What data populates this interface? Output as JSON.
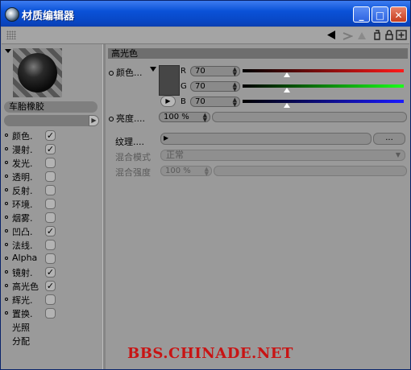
{
  "window": {
    "title": "材质编辑器",
    "minimize": "_",
    "maximize": "□",
    "close": "✕"
  },
  "material": {
    "name": "车胎橡胶"
  },
  "channels": [
    {
      "label": "颜色.",
      "checked": true,
      "dot": true
    },
    {
      "label": "漫射.",
      "checked": true,
      "dot": true
    },
    {
      "label": "发光.",
      "checked": false,
      "dot": true
    },
    {
      "label": "透明.",
      "checked": false,
      "dot": true
    },
    {
      "label": "反射.",
      "checked": false,
      "dot": true
    },
    {
      "label": "环境.",
      "checked": false,
      "dot": true
    },
    {
      "label": "烟雾.",
      "checked": false,
      "dot": true
    },
    {
      "label": "凹凸.",
      "checked": true,
      "dot": true
    },
    {
      "label": "法线.",
      "checked": false,
      "dot": true
    },
    {
      "label": "Alpha",
      "checked": false,
      "dot": true
    },
    {
      "label": "镜射.",
      "checked": true,
      "dot": true
    },
    {
      "label": "高光色",
      "checked": true,
      "dot": true
    },
    {
      "label": "辉光.",
      "checked": false,
      "dot": true
    },
    {
      "label": "置换.",
      "checked": false,
      "dot": true
    },
    {
      "label": "光照",
      "checked": null,
      "dot": false
    },
    {
      "label": "分配",
      "checked": null,
      "dot": false
    }
  ],
  "panel": {
    "header": "高光色",
    "color_label": "颜色...",
    "r_label": "R",
    "g_label": "G",
    "b_label": "B",
    "r_value": "70",
    "g_value": "70",
    "b_value": "70",
    "swatch_color": "#464646",
    "brightness_label": "亮度....",
    "brightness_value": "100 %",
    "texture_label": "纹理....",
    "texture_more": "...",
    "blend_mode_label": "混合模式",
    "blend_mode_value": "正常",
    "blend_strength_label": "混合强度",
    "blend_strength_value": "100 %"
  },
  "watermark": "BBS.CHINADE.NET"
}
